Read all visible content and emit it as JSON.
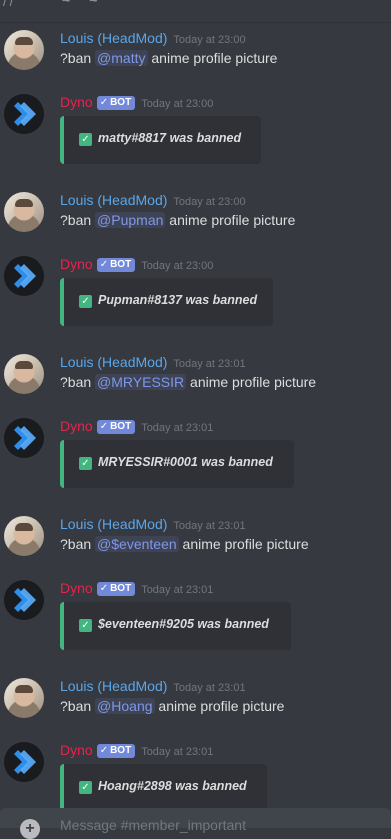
{
  "colors": {
    "background": "#36393f",
    "user_name": "#5aa6ea",
    "bot_name": "#e8234d",
    "bot_badge": "#7289da",
    "embed_accent": "#43b581",
    "embed_bg": "#2f3136",
    "mention": "#7f97e6"
  },
  "messages": [
    {
      "type": "user",
      "author": "Louis (HeadMod)",
      "timestamp": "Today at 23:00",
      "prefix": "?ban ",
      "mention": "@matty",
      "suffix": " anime profile picture"
    },
    {
      "type": "bot",
      "author": "Dyno",
      "badge": "BOT",
      "timestamp": "Today at 23:00",
      "embed_text": "matty#8817 was banned"
    },
    {
      "type": "user",
      "author": "Louis (HeadMod)",
      "timestamp": "Today at 23:00",
      "prefix": "?ban ",
      "mention": "@Pupman",
      "suffix": " anime profile picture"
    },
    {
      "type": "bot",
      "author": "Dyno",
      "badge": "BOT",
      "timestamp": "Today at 23:00",
      "embed_text": "Pupman#8137 was banned"
    },
    {
      "type": "user",
      "author": "Louis (HeadMod)",
      "timestamp": "Today at 23:01",
      "prefix": "?ban ",
      "mention": "@MRYESSIR",
      "suffix": " anime profile picture"
    },
    {
      "type": "bot",
      "author": "Dyno",
      "badge": "BOT",
      "timestamp": "Today at 23:01",
      "embed_text": "MRYESSIR#0001 was banned"
    },
    {
      "type": "user",
      "author": "Louis (HeadMod)",
      "timestamp": "Today at 23:01",
      "prefix": "?ban ",
      "mention": "@$eventeen",
      "suffix": " anime profile picture"
    },
    {
      "type": "bot",
      "author": "Dyno",
      "badge": "BOT",
      "timestamp": "Today at 23:01",
      "embed_text": "$eventeen#9205 was banned"
    },
    {
      "type": "user",
      "author": "Louis (HeadMod)",
      "timestamp": "Today at 23:01",
      "prefix": "?ban ",
      "mention": "@Hoang",
      "suffix": " anime profile picture"
    },
    {
      "type": "bot",
      "author": "Dyno",
      "badge": "BOT",
      "timestamp": "Today at 23:01",
      "embed_text": "Hoang#2898 was banned"
    }
  ],
  "composer": {
    "placeholder": "Message #member_important"
  }
}
